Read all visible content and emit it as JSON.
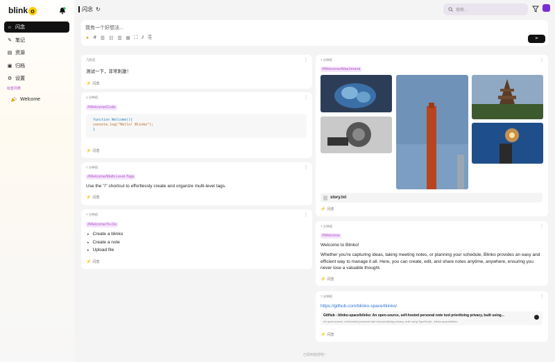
{
  "app": {
    "logo_text": "blink",
    "logo_o": "o"
  },
  "sidebar": {
    "items": [
      {
        "label": "闪念",
        "icon": "lightbulb-icon",
        "active": true
      },
      {
        "label": "笔记",
        "icon": "note-icon",
        "active": false
      },
      {
        "label": "资源",
        "icon": "resources-icon",
        "active": false
      },
      {
        "label": "归档",
        "icon": "archive-icon",
        "active": false
      },
      {
        "label": "设置",
        "icon": "settings-icon",
        "active": false
      }
    ],
    "tags_label": "标签列表",
    "tags": [
      {
        "label": "Welcome",
        "icon": "party-icon"
      }
    ]
  },
  "topbar": {
    "title": "闪念",
    "search_placeholder": "搜索..."
  },
  "editor": {
    "placeholder": "我有一个好想法...",
    "tools": [
      "#",
      "☰",
      "☷",
      "☰",
      "⊞",
      "⛶",
      "⫽",
      "⎘"
    ],
    "send": "➢"
  },
  "left_cards": [
    {
      "meta": "几秒前",
      "body": "测试一下，非常刺激！",
      "footer": "闪念"
    },
    {
      "meta": "1 分钟前",
      "tag": "#Welcome/Code",
      "code": [
        "function Welcome(){",
        "  console.log(\"Hello! Blinko\");",
        "}"
      ],
      "footer": "闪念"
    },
    {
      "meta": "7 分钟前",
      "tag": "#Welcome/Multi-Level-Tags",
      "body": "Use the \"/\" shortcut to effortlessly create and organize multi-level tags.",
      "footer": "闪念"
    },
    {
      "meta": "7 分钟前",
      "tag": "#Welcome/To-Do",
      "todos": [
        "Create a blinko",
        "Create a note",
        "Upload file"
      ],
      "footer": "闪念"
    }
  ],
  "right_cards": [
    {
      "meta": "7 分钟前",
      "tag": "#Welcome/Attachment",
      "file": "story.txt",
      "footer": "闪念"
    },
    {
      "meta": "7 分钟前",
      "tag": "#Welcome",
      "title": "Welcome to Blinko!",
      "body": "Whether you're capturing ideas, taking meeting notes, or planning your schedule, Blinko provides an easy and efficient way to manage it all. Here, you can create, edit, and share notes anytime, anywhere, ensuring you never lose a valuable thought.",
      "footer": "闪念"
    },
    {
      "meta": "7 分钟前",
      "link": "https://github.com/blinko-space/blinko/",
      "lp_title": "GitHub - blinko-space/blinko: An open-source, self-hosted personal note tool prioritizing privacy, built using...",
      "lp_desc": "An open-source, self-hosted personal note tool prioritizing privacy, built using TypeScript - blinko-space/blinko",
      "footer": "闪念"
    }
  ],
  "bottom_note": "已经到底部啦~"
}
